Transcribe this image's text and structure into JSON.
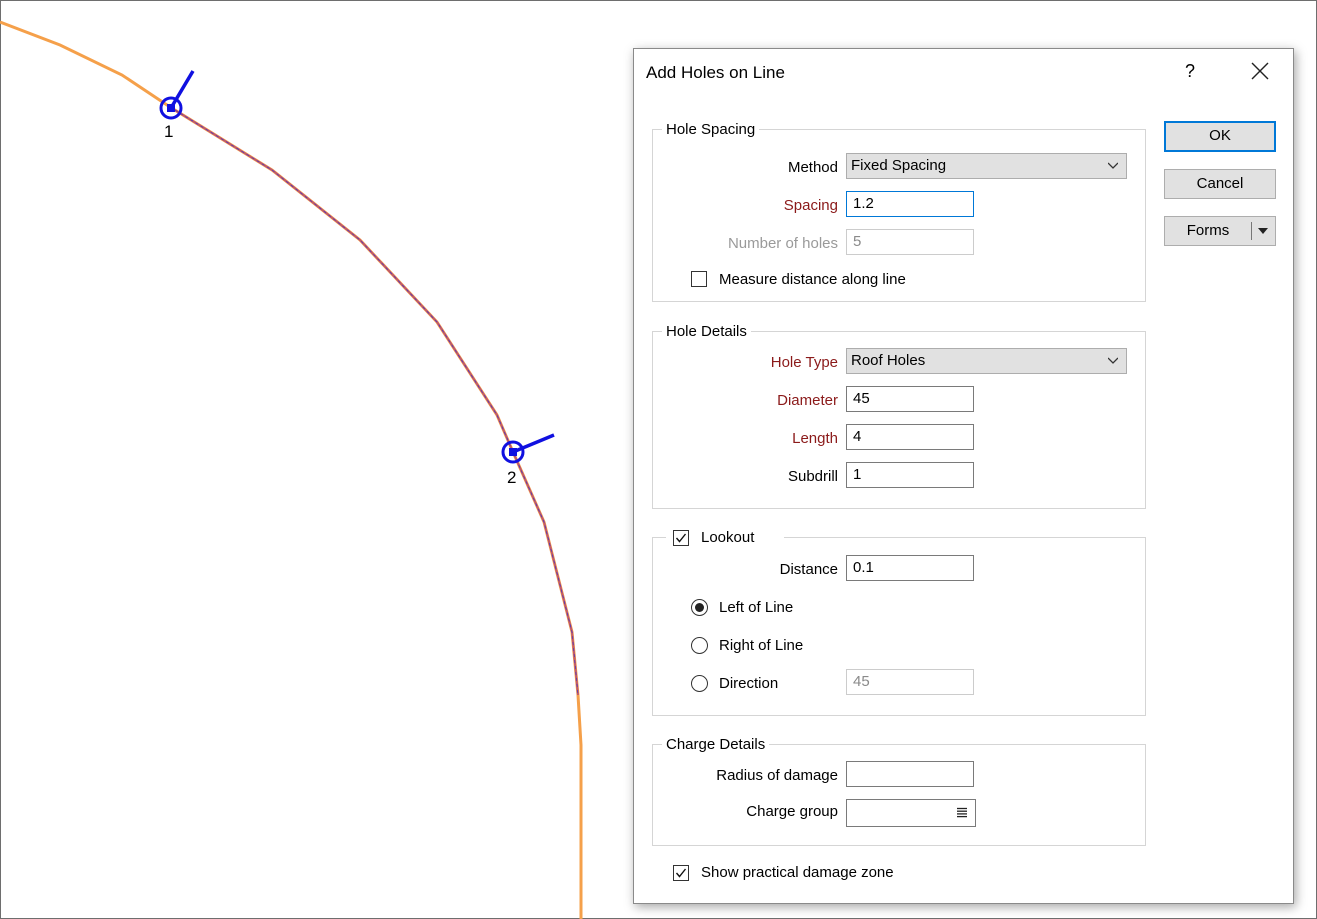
{
  "map": {
    "holes": [
      {
        "label": "1"
      },
      {
        "label": "2"
      }
    ]
  },
  "dialog": {
    "title": "Add Holes on Line",
    "help_label": "?",
    "hole_spacing": {
      "title": "Hole Spacing",
      "method_label": "Method",
      "method_value": "Fixed Spacing",
      "spacing_label": "Spacing",
      "spacing_value": "1.2",
      "number_of_holes_label": "Number of holes",
      "number_of_holes_value": "5",
      "measure_label": "Measure distance along line",
      "measure_checked": false
    },
    "hole_details": {
      "title": "Hole Details",
      "hole_type_label": "Hole Type",
      "hole_type_value": "Roof Holes",
      "diameter_label": "Diameter",
      "diameter_value": "45",
      "length_label": "Length",
      "length_value": "4",
      "subdrill_label": "Subdrill",
      "subdrill_value": "1"
    },
    "lookout": {
      "title": "Lookout",
      "checked": true,
      "distance_label": "Distance",
      "distance_value": "0.1",
      "left_label": "Left of Line",
      "right_label": "Right of Line",
      "direction_label": "Direction",
      "direction_value": "45",
      "selected": "left"
    },
    "charge_details": {
      "title": "Charge Details",
      "radius_label": "Radius of damage",
      "radius_value": "",
      "charge_group_label": "Charge group",
      "charge_group_value": ""
    },
    "show_damage_label": "Show practical damage zone",
    "show_damage_checked": true,
    "buttons": {
      "ok": "OK",
      "cancel": "Cancel",
      "forms": "Forms"
    }
  },
  "colors": {
    "design_line": "#f5a04a",
    "selected_line": "#c05a6a",
    "hole_marker": "#1010e0",
    "required_label": "#8b1a1a",
    "accent": "#0078d7"
  }
}
